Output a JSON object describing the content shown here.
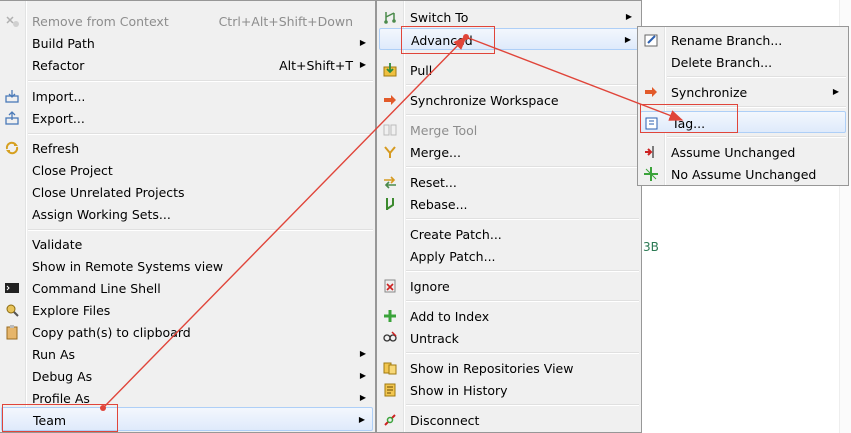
{
  "context_menu": {
    "items": [
      {
        "label": "Remove from Context",
        "shortcut": "Ctrl+Alt+Shift+Down",
        "disabled": true,
        "icon": "remove-context-icon"
      },
      {
        "label": "Build Path",
        "submenu": true
      },
      {
        "label": "Refactor",
        "shortcut": "Alt+Shift+T",
        "submenu": true
      },
      {
        "label": "Import...",
        "icon": "import-icon"
      },
      {
        "label": "Export...",
        "icon": "export-icon"
      },
      {
        "label": "Refresh",
        "icon": "refresh-icon"
      },
      {
        "label": "Close Project"
      },
      {
        "label": "Close Unrelated Projects"
      },
      {
        "label": "Assign Working Sets..."
      },
      {
        "label": "Validate"
      },
      {
        "label": "Show in Remote Systems view"
      },
      {
        "label": "Command Line Shell",
        "icon": "terminal-icon"
      },
      {
        "label": "Explore Files",
        "icon": "explore-files-icon"
      },
      {
        "label": "Copy path(s) to clipboard",
        "icon": "clipboard-icon"
      },
      {
        "label": "Run As",
        "submenu": true
      },
      {
        "label": "Debug As",
        "submenu": true
      },
      {
        "label": "Profile As",
        "submenu": true
      },
      {
        "label": "Team",
        "submenu": true
      }
    ]
  },
  "team_menu": {
    "items": [
      {
        "label": "Switch To",
        "submenu": true,
        "icon": "switch-branch-icon"
      },
      {
        "label": "Advanced",
        "submenu": true
      },
      {
        "label": "Pull",
        "icon": "pull-icon"
      },
      {
        "label": "Synchronize Workspace",
        "icon": "synchronize-icon"
      },
      {
        "label": "Merge Tool",
        "disabled": true,
        "icon": "merge-tool-icon"
      },
      {
        "label": "Merge...",
        "icon": "merge-icon"
      },
      {
        "label": "Reset...",
        "icon": "reset-icon"
      },
      {
        "label": "Rebase...",
        "icon": "rebase-icon"
      },
      {
        "label": "Create Patch..."
      },
      {
        "label": "Apply Patch..."
      },
      {
        "label": "Ignore",
        "icon": "ignore-icon"
      },
      {
        "label": "Add to Index",
        "icon": "add-index-icon"
      },
      {
        "label": "Untrack",
        "icon": "untrack-icon"
      },
      {
        "label": "Show in Repositories View",
        "icon": "repositories-icon"
      },
      {
        "label": "Show in History",
        "icon": "history-icon"
      },
      {
        "label": "Disconnect",
        "icon": "disconnect-icon"
      }
    ]
  },
  "advanced_menu": {
    "items": [
      {
        "label": "Rename Branch...",
        "icon": "rename-branch-icon"
      },
      {
        "label": "Delete Branch..."
      },
      {
        "label": "Synchronize",
        "submenu": true,
        "icon": "synchronize-icon"
      },
      {
        "label": "Tag...",
        "icon": "tag-icon"
      },
      {
        "label": "Assume Unchanged",
        "icon": "assume-unchanged-icon"
      },
      {
        "label": "No Assume Unchanged",
        "icon": "no-assume-unchanged-icon"
      }
    ]
  },
  "background_fragment": "3B",
  "colors": {
    "annotation": "#e0453a",
    "menu_bg": "#f0f0f0",
    "highlight_border": "#aecff7"
  }
}
